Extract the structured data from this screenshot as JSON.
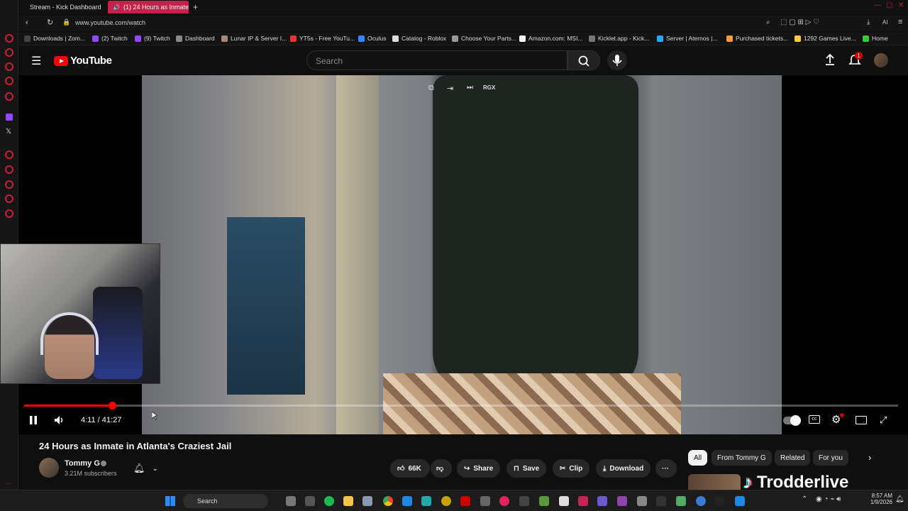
{
  "browser": {
    "tabs": [
      {
        "label": "Stream - Kick Dashboard",
        "active": false
      },
      {
        "label": "(1) 24 Hours as Inmate",
        "active": true
      }
    ],
    "url": "www.youtube.com/watch",
    "bookmarks": [
      "Downloads | Zom...",
      "(2) Twitch",
      "(9) Twitch",
      "Dashboard",
      "Lunar IP & Server I...",
      "YT5s - Free YouTu...",
      "Oculus",
      "Catalog - Roblox",
      "Choose Your Parts...",
      "Amazon.com: MSI...",
      "Kicklet.app - Kick...",
      "Server | Aternos |...",
      "Purchased tickets...",
      "1292 Games Live...",
      "Home"
    ],
    "ext_label": "AI"
  },
  "youtube": {
    "logo_text": "YouTube",
    "search_placeholder": "Search",
    "notification_count": "1"
  },
  "player": {
    "overlay_label": "RGX",
    "time_current": "4:11",
    "time_separator": "/",
    "time_total": "41:27",
    "progress": 0.101
  },
  "video": {
    "title": "24 Hours as Inmate in Atlanta's Craziest Jail",
    "channel_name": "Tommy G",
    "subscribers": "3.21M subscribers",
    "likes": "66K",
    "share_label": "Share",
    "save_label": "Save",
    "clip_label": "Clip",
    "download_label": "Download"
  },
  "chips": [
    "All",
    "From Tommy G",
    "Related",
    "For you"
  ],
  "watermark": "Trodderlive",
  "taskbar": {
    "search_label": "Search",
    "time": "8:57 AM",
    "date": "1/9/2026"
  },
  "colors": {
    "accent": "#ff0000",
    "tab_active": "#c8204a",
    "bg": "#0f0f0f"
  }
}
